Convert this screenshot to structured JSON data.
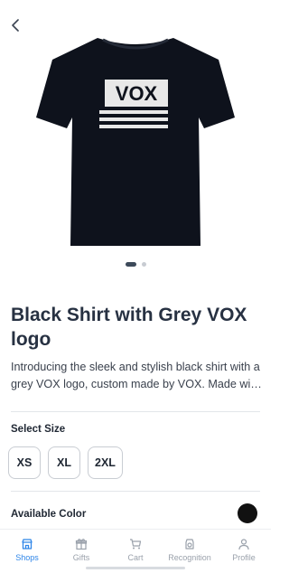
{
  "product": {
    "title": "Black Shirt with Grey VOX logo",
    "description": "Introducing the sleek and stylish black shirt with a grey VOX logo, custom made by VOX. Made with premium quality fabric for all-day comfort.",
    "image_logo_text": "VOX",
    "images_count": 2,
    "active_image": 0
  },
  "size_section": {
    "label": "Select Size",
    "options": [
      "XS",
      "XL",
      "2XL"
    ]
  },
  "color_section": {
    "label": "Available Color",
    "colors": [
      "#111111"
    ]
  },
  "nav": {
    "items": [
      {
        "label": "Shops",
        "icon": "shop-icon",
        "active": true
      },
      {
        "label": "Gifts",
        "icon": "gift-icon",
        "active": false
      },
      {
        "label": "Cart",
        "icon": "cart-icon",
        "active": false
      },
      {
        "label": "Recognition",
        "icon": "recognition-icon",
        "active": false
      },
      {
        "label": "Profile",
        "icon": "profile-icon",
        "active": false
      }
    ]
  },
  "colors": {
    "accent": "#2f86e8",
    "title": "#273142",
    "shirt": "#0e121c"
  }
}
